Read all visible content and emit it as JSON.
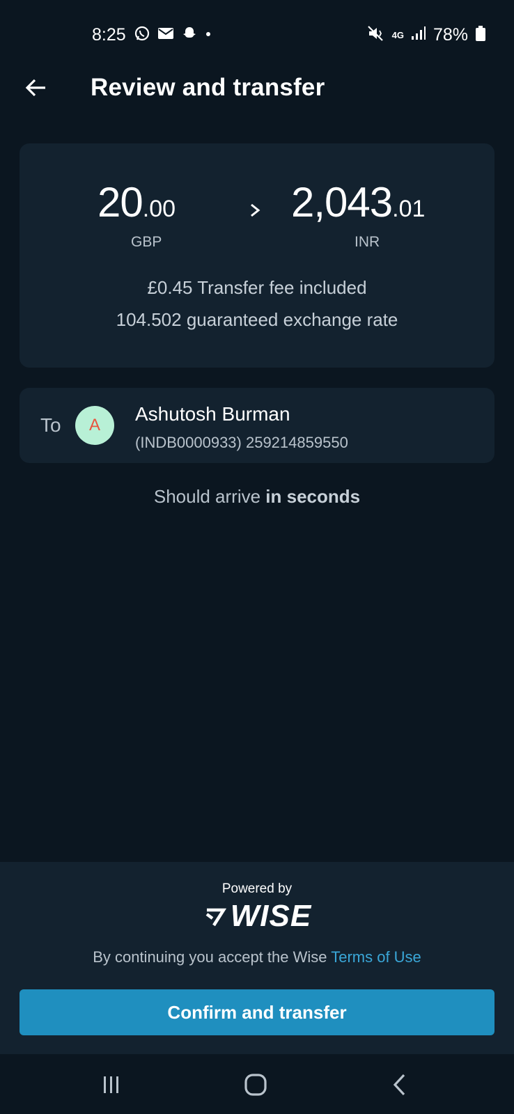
{
  "status_bar": {
    "time": "8:25",
    "network": "4G",
    "battery": "78%"
  },
  "header": {
    "title": "Review and transfer"
  },
  "summary": {
    "send_amount_whole": "20",
    "send_amount_decimal": ".00",
    "send_currency": "GBP",
    "receive_amount_whole": "2,043",
    "receive_amount_decimal": ".01",
    "receive_currency": "INR",
    "fee_value": "£0.45",
    "fee_text": " Transfer fee included",
    "rate_value": "104.502",
    "rate_text": " guaranteed exchange rate"
  },
  "recipient": {
    "to_label": "To",
    "avatar_initial": "A",
    "name": "Ashutosh Burman",
    "account": "(INDB0000933) 259214859550"
  },
  "arrival": {
    "prefix": "Should arrive ",
    "emphasis": "in seconds"
  },
  "footer": {
    "powered_by": "Powered by",
    "brand": "WISE",
    "terms_prefix": "By continuing you accept the Wise ",
    "terms_link": "Terms of Use",
    "confirm_label": "Confirm and transfer"
  },
  "colors": {
    "background": "#0b1620",
    "card": "#13222f",
    "accent": "#1f8fbf",
    "link": "#3aa7d8",
    "avatar_bg": "#b8f0d6",
    "avatar_text": "#e8553f"
  }
}
